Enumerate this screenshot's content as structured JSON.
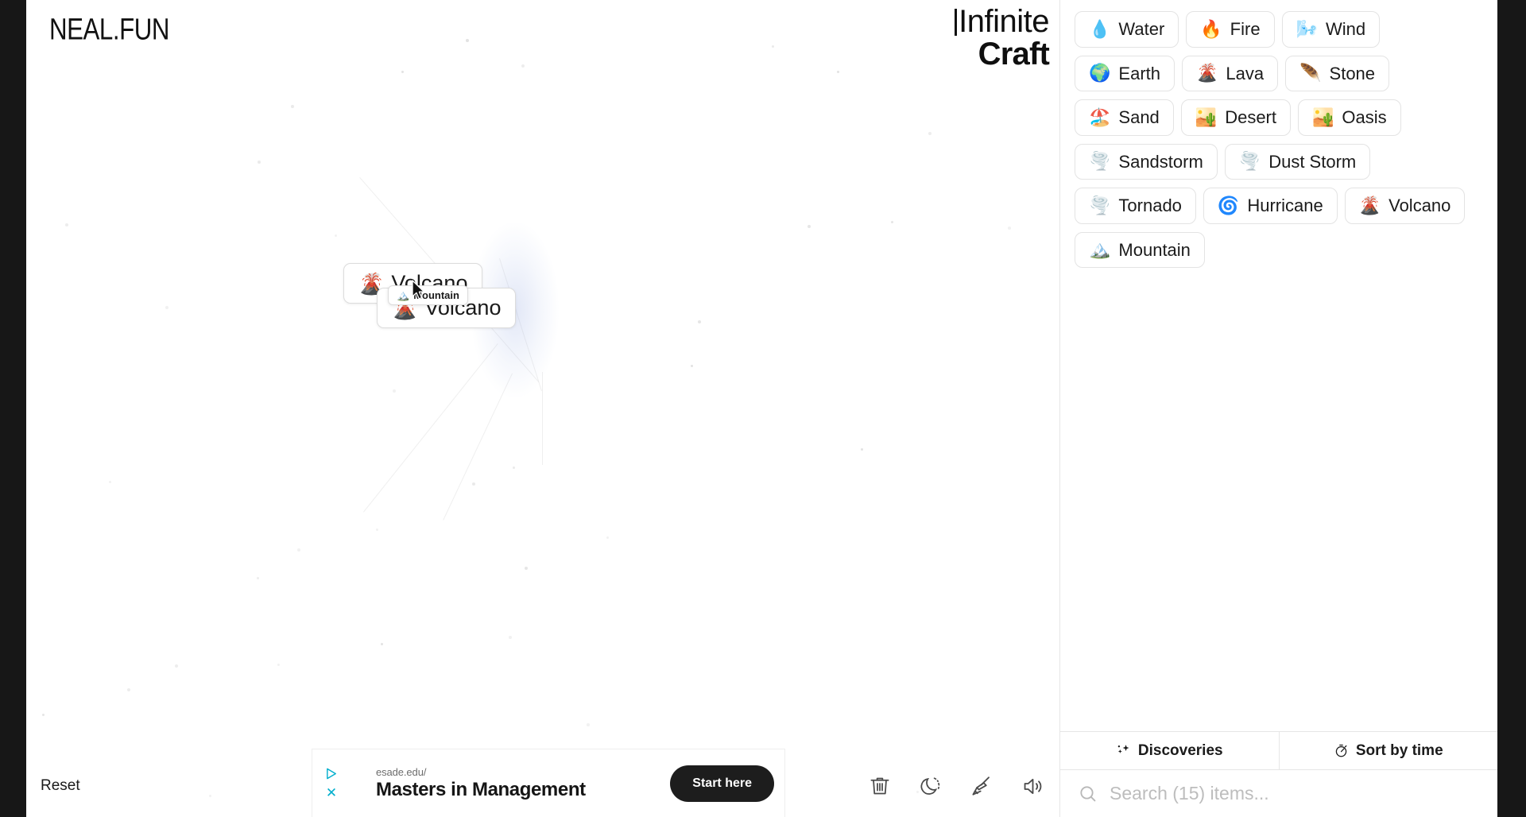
{
  "site": {
    "wordmark": "NEAL.FUN"
  },
  "game": {
    "title_line1": "Infinite",
    "title_line2": "Craft"
  },
  "canvas": {
    "reset_label": "Reset",
    "cards": [
      {
        "emoji": "🌋",
        "label": "Volcano",
        "icon_name": "volcano-emoji"
      },
      {
        "emoji": "🌋",
        "label": "Volcano",
        "icon_name": "volcano-emoji"
      }
    ],
    "dragging_card": {
      "emoji": "🏔️",
      "label": "Mountain",
      "icon_name": "mountain-emoji"
    },
    "tools": [
      {
        "name": "trash-icon",
        "title": "Clear board"
      },
      {
        "name": "moon-icon",
        "title": "Dark mode"
      },
      {
        "name": "broom-icon",
        "title": "Tidy up"
      },
      {
        "name": "speaker-icon",
        "title": "Sound"
      }
    ]
  },
  "ad": {
    "url": "esade.edu/",
    "headline": "Masters in Management",
    "cta_label": "Start here",
    "adchoices_icon": "adchoices-icon",
    "close_icon": "close-icon"
  },
  "sidebar": {
    "items": [
      {
        "emoji": "💧",
        "label": "Water",
        "icon_name": "water-droplet-emoji"
      },
      {
        "emoji": "🔥",
        "label": "Fire",
        "icon_name": "fire-emoji"
      },
      {
        "emoji": "🌬️",
        "label": "Wind",
        "icon_name": "wind-emoji"
      },
      {
        "emoji": "🌍",
        "label": "Earth",
        "icon_name": "earth-globe-emoji"
      },
      {
        "emoji": "🌋",
        "label": "Lava",
        "icon_name": "volcano-emoji"
      },
      {
        "emoji": "🪶",
        "label": "Stone",
        "icon_name": "rock-emoji"
      },
      {
        "emoji": "🏖️",
        "label": "Sand",
        "icon_name": "beach-emoji"
      },
      {
        "emoji": "🏜️",
        "label": "Desert",
        "icon_name": "desert-emoji"
      },
      {
        "emoji": "🏜️",
        "label": "Oasis",
        "icon_name": "desert-emoji"
      },
      {
        "emoji": "🌪️",
        "label": "Sandstorm",
        "icon_name": "tornado-emoji"
      },
      {
        "emoji": "🌪️",
        "label": "Dust Storm",
        "icon_name": "tornado-emoji"
      },
      {
        "emoji": "🌪️",
        "label": "Tornado",
        "icon_name": "tornado-emoji"
      },
      {
        "emoji": "🌀",
        "label": "Hurricane",
        "icon_name": "cyclone-emoji"
      },
      {
        "emoji": "🌋",
        "label": "Volcano",
        "icon_name": "volcano-emoji"
      },
      {
        "emoji": "🏔️",
        "label": "Mountain",
        "icon_name": "mountain-emoji"
      }
    ],
    "tabs": [
      {
        "label": "Discoveries",
        "icon_name": "sparkles-icon"
      },
      {
        "label": "Sort by time",
        "icon_name": "stopwatch-icon"
      }
    ],
    "search": {
      "placeholder": "Search (15) items...",
      "value": ""
    }
  },
  "colors": {
    "accent_blue": "#00aecd",
    "pill_border": "#e3e3e3",
    "text": "#1b1b1b",
    "muted": "#bdbdbd",
    "cta_bg": "#1d1d1d"
  }
}
